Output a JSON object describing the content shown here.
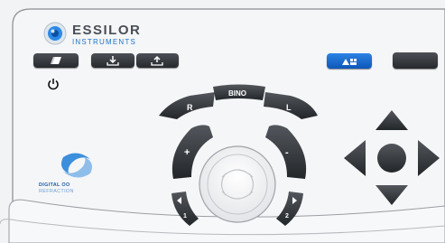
{
  "header": {
    "brand": "ESSILOR",
    "brand_sub": "INSTRUMENTS"
  },
  "left_controls": {
    "buttons": [
      {
        "icon": "eraser-icon"
      },
      {
        "icon": "download-icon"
      },
      {
        "icon": "upload-icon"
      }
    ],
    "power_icon": "power-icon"
  },
  "right_controls": {
    "blue_button_icon": "chart-mode-icon",
    "blank_button": ""
  },
  "footer_logo": {
    "line1": "DIGITAL OO",
    "line2": "REFRACTION"
  },
  "wheel_labels": {
    "right_eye": "R",
    "bino": "BINO",
    "left_eye": "L",
    "plus": "+",
    "minus": "-",
    "step_back": "1",
    "step_forward": "2"
  },
  "colors": {
    "key_dark": "#2b2e33",
    "key_blue": "#1565c8",
    "panel": "#f2f3f4",
    "brand_blue": "#1e73c8"
  }
}
